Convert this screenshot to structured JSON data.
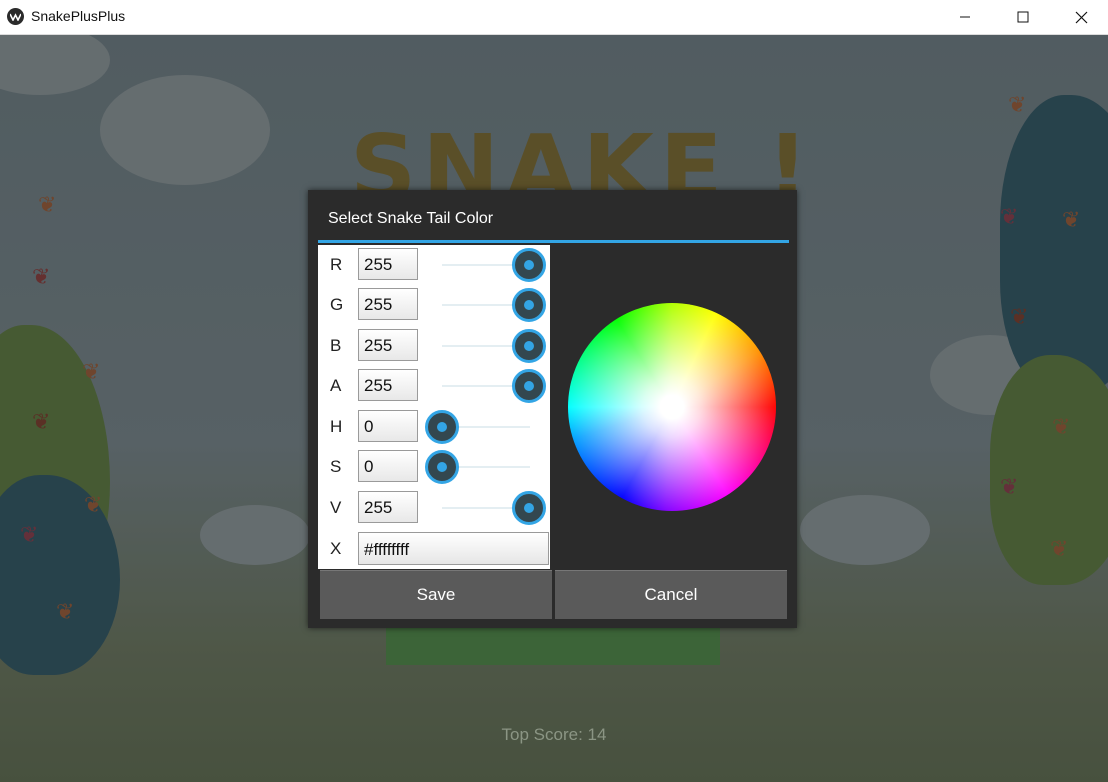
{
  "window": {
    "title": "SnakePlusPlus",
    "controls": [
      "minimize-icon",
      "maximize-icon",
      "close-icon"
    ]
  },
  "background": {
    "logo_text": "SNAKE !",
    "top_score": "Top Score: 14"
  },
  "dialog": {
    "title": "Select Snake Tail Color",
    "accent_color": "#33a5e5",
    "rows": [
      {
        "label": "R",
        "value": "255",
        "level": 1.0
      },
      {
        "label": "G",
        "value": "255",
        "level": 1.0
      },
      {
        "label": "B",
        "value": "255",
        "level": 1.0
      },
      {
        "label": "A",
        "value": "255",
        "level": 1.0
      },
      {
        "label": "H",
        "value": "0",
        "level": 0.0
      },
      {
        "label": "S",
        "value": "0",
        "level": 0.0
      },
      {
        "label": "V",
        "value": "255",
        "level": 1.0
      }
    ],
    "hex": {
      "label": "X",
      "value": "#ffffffff"
    },
    "save_label": "Save",
    "cancel_label": "Cancel"
  }
}
